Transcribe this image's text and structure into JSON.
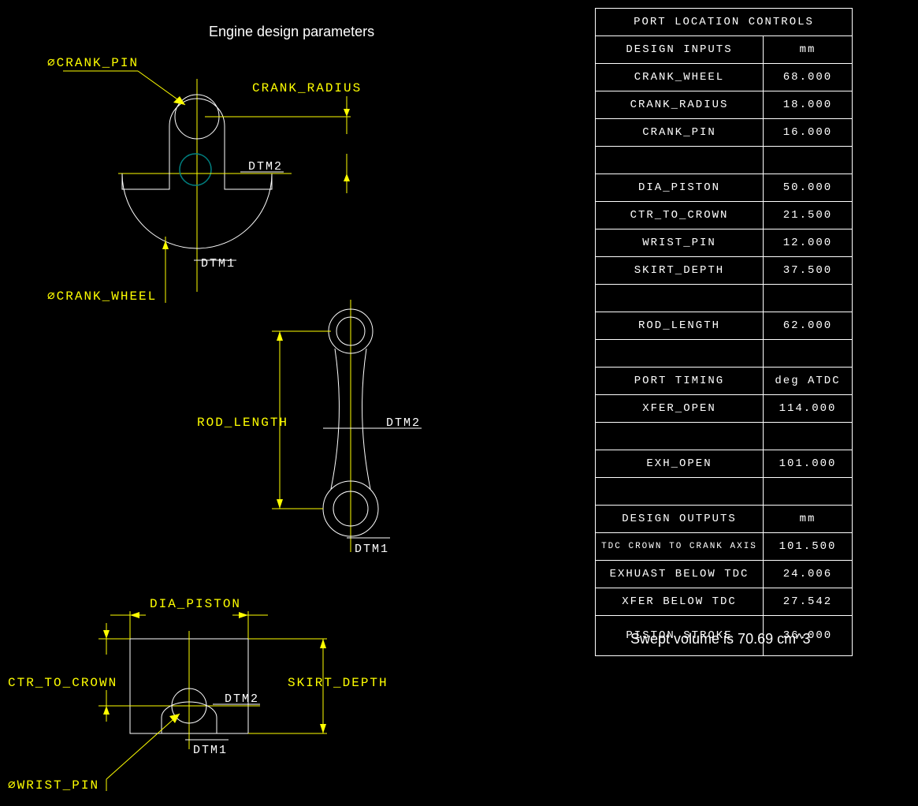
{
  "title": "Engine design parameters",
  "labels": {
    "crank_pin": "CRANK_PIN",
    "crank_radius": "CRANK_RADIUS",
    "crank_wheel": "CRANK_WHEEL",
    "dtm1": "DTM1",
    "dtm2": "DTM2",
    "rod_length": "ROD_LENGTH",
    "dia_piston": "DIA_PISTON",
    "ctr_to_crown": "CTR_TO_CROWN",
    "skirt_depth": "SKIRT_DEPTH",
    "wrist_pin": "WRIST_PIN",
    "diameter_sym": "⌀"
  },
  "table": {
    "header": "PORT LOCATION CONTROLS",
    "rows": [
      {
        "name": "DESIGN INPUTS",
        "val": "mm"
      },
      {
        "name": "CRANK_WHEEL",
        "val": "68.000"
      },
      {
        "name": "CRANK_RADIUS",
        "val": "18.000"
      },
      {
        "name": "CRANK_PIN",
        "val": "16.000"
      },
      {
        "name": "",
        "val": ""
      },
      {
        "name": "DIA_PISTON",
        "val": "50.000"
      },
      {
        "name": "CTR_TO_CROWN",
        "val": "21.500"
      },
      {
        "name": "WRIST_PIN",
        "val": "12.000"
      },
      {
        "name": "SKIRT_DEPTH",
        "val": "37.500"
      },
      {
        "name": "",
        "val": ""
      },
      {
        "name": "ROD_LENGTH",
        "val": "62.000"
      },
      {
        "name": "",
        "val": ""
      },
      {
        "name": "PORT TIMING",
        "val": "deg ATDC"
      },
      {
        "name": "XFER_OPEN",
        "val": "114.000"
      },
      {
        "name": "",
        "val": ""
      },
      {
        "name": "EXH_OPEN",
        "val": "101.000"
      },
      {
        "name": "",
        "val": ""
      },
      {
        "name": "DESIGN OUTPUTS",
        "val": "mm"
      },
      {
        "name": "TDC CROWN TO CRANK AXIS",
        "val": "101.500",
        "small": true
      },
      {
        "name": "EXHUAST BELOW TDC",
        "val": "24.006"
      },
      {
        "name": "XFER BELOW TDC",
        "val": "27.542"
      },
      {
        "name": "PISTON STROKE",
        "val": "36.000",
        "tall": true
      }
    ]
  },
  "caption": "Swept volume is 70.69 cm^3"
}
